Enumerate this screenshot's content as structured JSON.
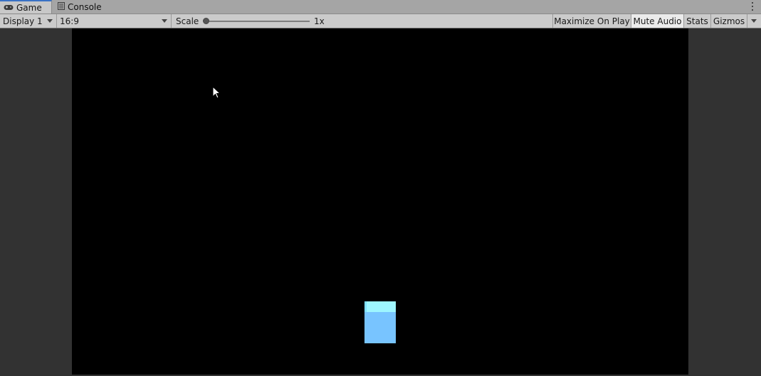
{
  "tabs": [
    {
      "label": "Game",
      "icon": "gamepad-icon",
      "active": true
    },
    {
      "label": "Console",
      "icon": "console-icon",
      "active": false
    }
  ],
  "toolbar": {
    "display": "Display 1",
    "aspect": "16:9",
    "scale_label": "Scale",
    "scale_value": "1x",
    "maximize_on_play": "Maximize On Play",
    "mute_audio": "Mute Audio",
    "stats": "Stats",
    "gizmos": "Gizmos"
  },
  "colors": {
    "tab_accent": "#3a72c5",
    "cube_top": "#9ef6ff",
    "cube_front": "#78c4ff",
    "viewport_bg": "#000000"
  }
}
